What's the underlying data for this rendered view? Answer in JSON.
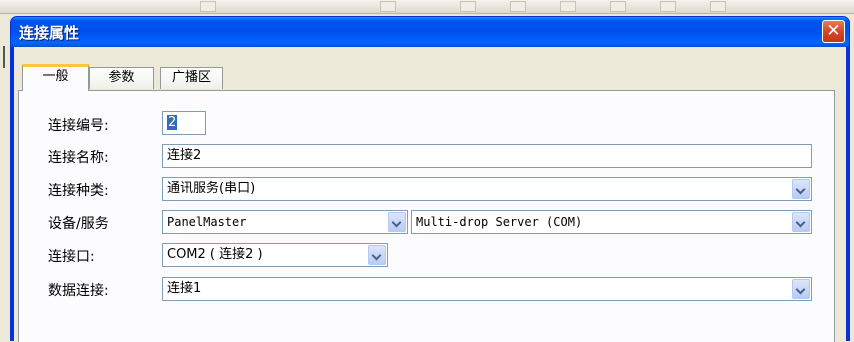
{
  "dialog": {
    "title": "连接属性",
    "close_glyph": "✕"
  },
  "tabs": [
    {
      "label": "一般",
      "active": true
    },
    {
      "label": "参数",
      "active": false
    },
    {
      "label": "广播区",
      "active": false
    }
  ],
  "form": {
    "conn_number": {
      "label": "连接编号:",
      "value": "2"
    },
    "conn_name": {
      "label": "连接名称:",
      "value": "连接2"
    },
    "conn_type": {
      "label": "连接种类:",
      "value": "通讯服务(串口)"
    },
    "device_service": {
      "label": "设备/服务",
      "device_value": "PanelMaster",
      "service_value": "Multi-drop Server (COM)"
    },
    "conn_port": {
      "label": "连接口:",
      "value": "COM2 ( 连接2 )"
    },
    "data_conn": {
      "label": "数据连接:",
      "value": "连接1"
    }
  }
}
